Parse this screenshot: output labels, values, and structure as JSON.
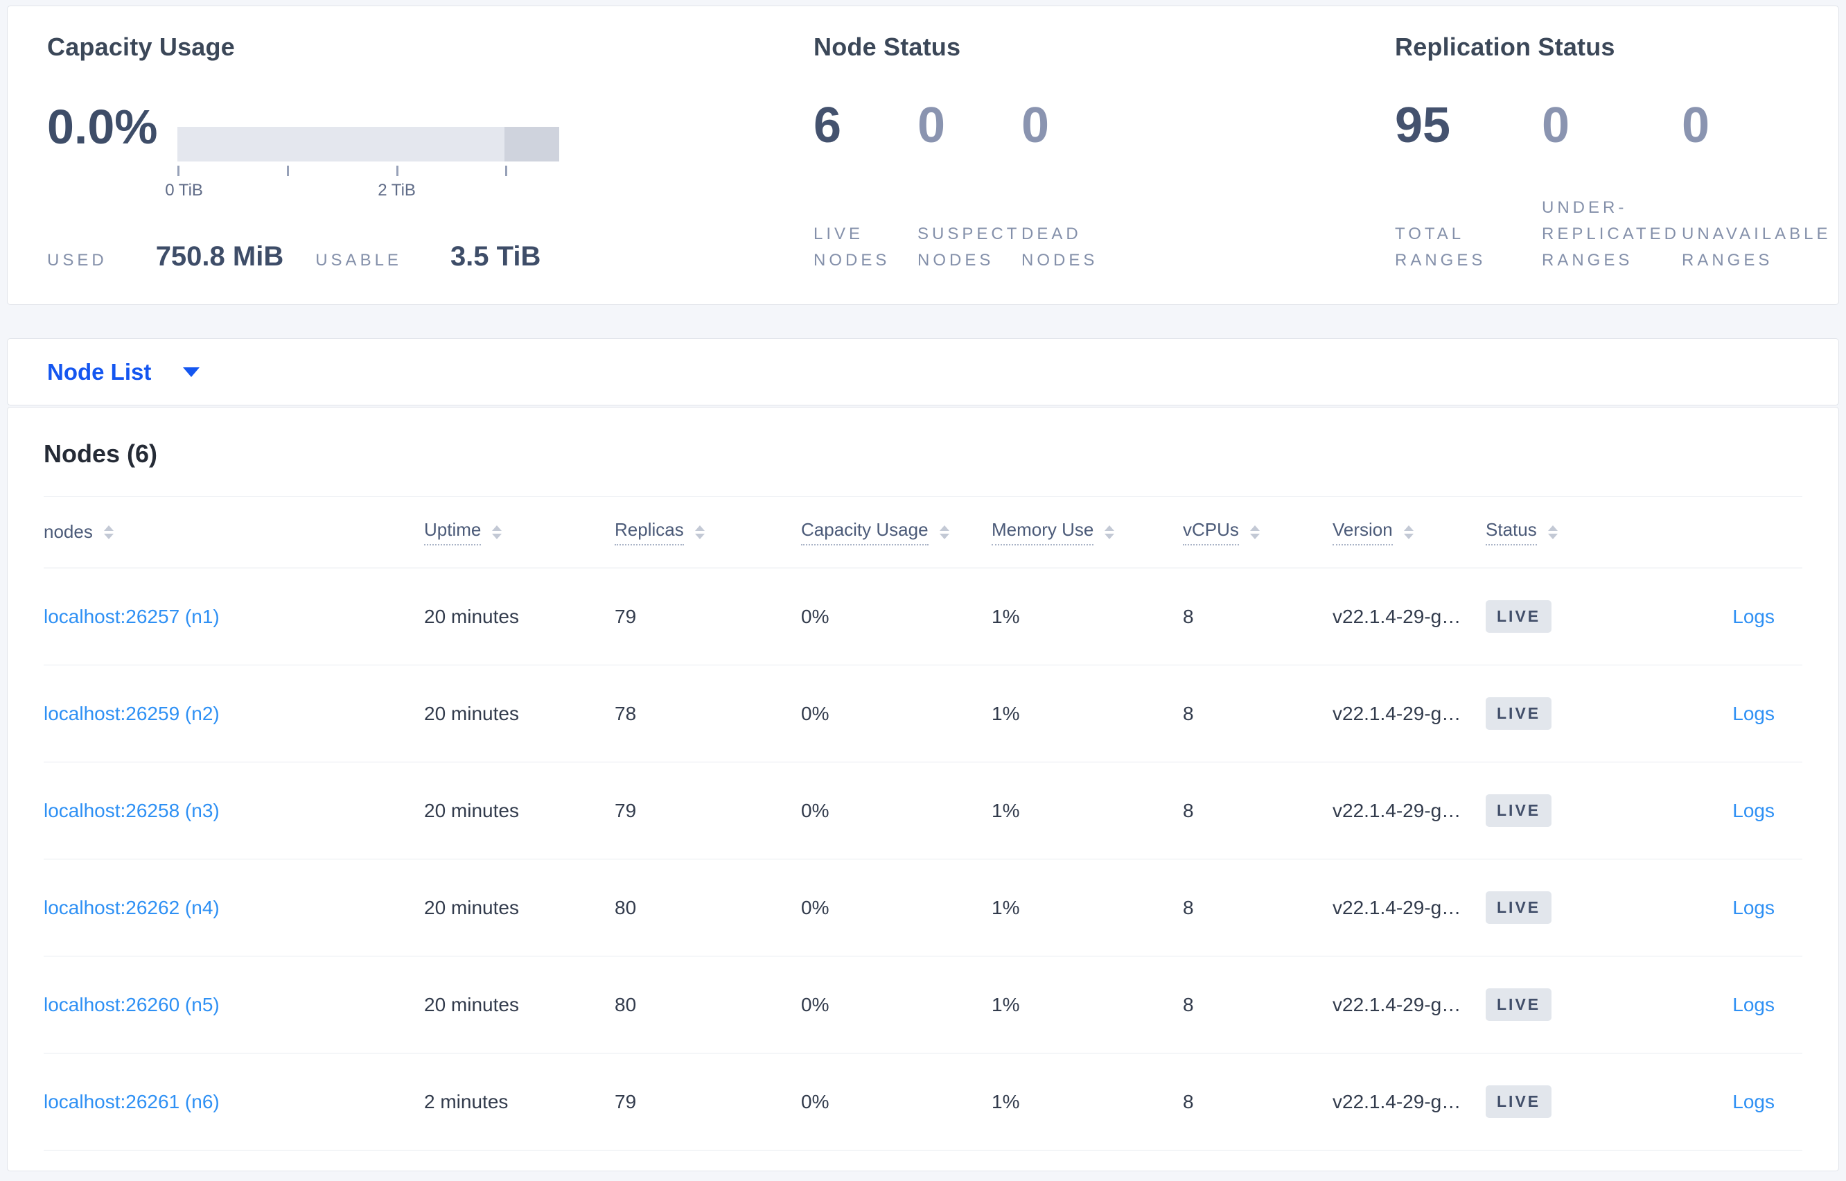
{
  "overview": {
    "capacity": {
      "title": "Capacity Usage",
      "percent": "0.0%",
      "tick_labels": [
        "0 TiB",
        "2 TiB"
      ],
      "used_label": "USED",
      "used_value": "750.8 MiB",
      "usable_label": "USABLE",
      "usable_value": "3.5 TiB"
    },
    "node_status": {
      "title": "Node Status",
      "metrics": [
        {
          "value": "6",
          "label": "LIVE NODES"
        },
        {
          "value": "0",
          "label": "SUSPECT NODES"
        },
        {
          "value": "0",
          "label": "DEAD NODES"
        }
      ]
    },
    "replication": {
      "title": "Replication Status",
      "metrics": [
        {
          "value": "95",
          "label": "TOTAL RANGES"
        },
        {
          "value": "0",
          "label": "UNDER-REPLICATED RANGES"
        },
        {
          "value": "0",
          "label": "UNAVAILABLE RANGES"
        }
      ]
    }
  },
  "node_list": {
    "label": "Node List"
  },
  "nodes_section": {
    "title": "Nodes (6)",
    "columns": [
      {
        "label": "nodes"
      },
      {
        "label": "Uptime"
      },
      {
        "label": "Replicas"
      },
      {
        "label": "Capacity Usage"
      },
      {
        "label": "Memory Use"
      },
      {
        "label": "vCPUs"
      },
      {
        "label": "Version"
      },
      {
        "label": "Status"
      }
    ],
    "rows": [
      {
        "node": "localhost:26257 (n1)",
        "uptime": "20 minutes",
        "replicas": "79",
        "capacity": "0%",
        "memory": "1%",
        "vcpus": "8",
        "version": "v22.1.4-29-g…",
        "status": "LIVE",
        "logs": "Logs"
      },
      {
        "node": "localhost:26259 (n2)",
        "uptime": "20 minutes",
        "replicas": "78",
        "capacity": "0%",
        "memory": "1%",
        "vcpus": "8",
        "version": "v22.1.4-29-g…",
        "status": "LIVE",
        "logs": "Logs"
      },
      {
        "node": "localhost:26258 (n3)",
        "uptime": "20 minutes",
        "replicas": "79",
        "capacity": "0%",
        "memory": "1%",
        "vcpus": "8",
        "version": "v22.1.4-29-g…",
        "status": "LIVE",
        "logs": "Logs"
      },
      {
        "node": "localhost:26262 (n4)",
        "uptime": "20 minutes",
        "replicas": "80",
        "capacity": "0%",
        "memory": "1%",
        "vcpus": "8",
        "version": "v22.1.4-29-g…",
        "status": "LIVE",
        "logs": "Logs"
      },
      {
        "node": "localhost:26260 (n5)",
        "uptime": "20 minutes",
        "replicas": "80",
        "capacity": "0%",
        "memory": "1%",
        "vcpus": "8",
        "version": "v22.1.4-29-g…",
        "status": "LIVE",
        "logs": "Logs"
      },
      {
        "node": "localhost:26261 (n6)",
        "uptime": "2 minutes",
        "replicas": "79",
        "capacity": "0%",
        "memory": "1%",
        "vcpus": "8",
        "version": "v22.1.4-29-g…",
        "status": "LIVE",
        "logs": "Logs"
      }
    ]
  },
  "colors": {
    "accent_blue": "#1456f0",
    "link_blue": "#2e90f4",
    "dark_slate": "#3e4d68",
    "muted_slate": "#8490aa",
    "bar_track": "#e4e7ee",
    "bar_reserved": "#cfd3dd",
    "badge_bg": "#e2e6ec"
  }
}
